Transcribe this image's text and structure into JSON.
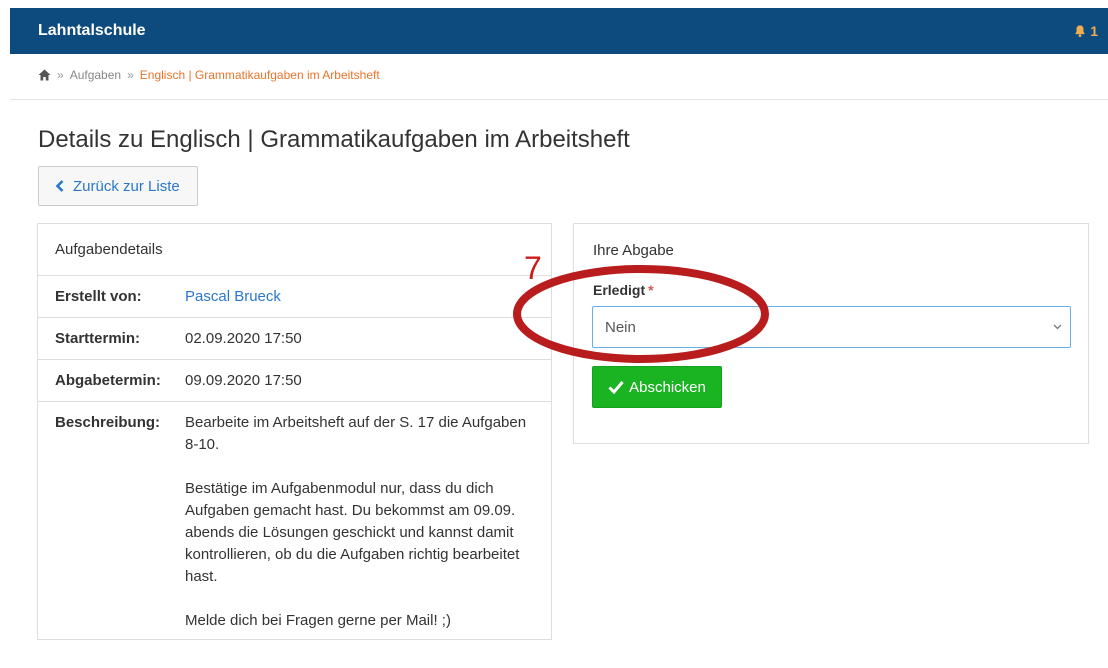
{
  "header": {
    "brand": "Lahntalschule",
    "notification_count": "1",
    "bg_color": "#0d4a7e"
  },
  "breadcrumb": {
    "home_icon": "home-icon",
    "separator": "»",
    "items": [
      "Aufgaben",
      "Englisch | Grammatikaufgaben im Arbeitsheft"
    ]
  },
  "page": {
    "title": "Details zu Englisch | Grammatikaufgaben im Arbeitsheft",
    "back_label": "Zurück zur Liste"
  },
  "details": {
    "heading": "Aufgabendetails",
    "created_by_label": "Erstellt von:",
    "created_by_value": "Pascal Brueck",
    "start_label": "Starttermin:",
    "start_value": "02.09.2020 17:50",
    "due_label": "Abgabetermin:",
    "due_value": "09.09.2020 17:50",
    "description_label": "Beschreibung:",
    "description_paragraphs": [
      "Bearbeite im Arbeitsheft auf der S. 17 die Aufgaben 8-10.",
      "Bestätige im Aufgabenmodul nur, dass du dich Aufgaben gemacht hast. Du bekommst am 09.09. abends die Lösungen geschickt und kannst damit kontrollieren, ob du die Aufgaben richtig bearbeitet hast.",
      "Melde dich bei Fragen gerne per Mail! ;)"
    ]
  },
  "submission": {
    "heading": "Ihre Abgabe",
    "field_label": "Erledigt",
    "required_mark": "*",
    "select_value": "Nein",
    "submit_label": "Abschicken",
    "submit_color": "#1ab322"
  },
  "annotation": {
    "number": "7",
    "color": "#cc1b1b"
  }
}
